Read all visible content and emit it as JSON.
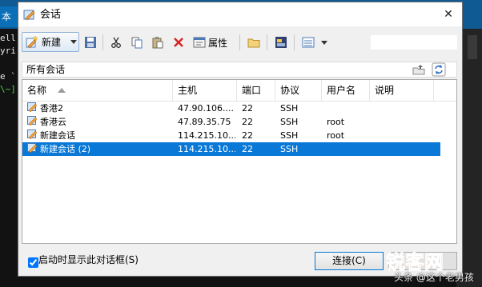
{
  "terminal": {
    "tab_label": "本",
    "lines": [
      "ell",
      "yri",
      "",
      "e `",
      "\\~]"
    ]
  },
  "dialog": {
    "title": "会话",
    "close_glyph": "✕"
  },
  "toolbar": {
    "new_label": "新建",
    "properties_label": "属性",
    "search_placeholder": ""
  },
  "folder": {
    "path": "所有会话"
  },
  "session_list": {
    "columns": [
      "名称",
      "主机",
      "端口",
      "协议",
      "用户名",
      "说明"
    ],
    "rows": [
      {
        "name": "香港2",
        "host": "47.90.106....",
        "port": "22",
        "protocol": "SSH",
        "user": "",
        "note": ""
      },
      {
        "name": "香港云",
        "host": "47.89.35.75",
        "port": "22",
        "protocol": "SSH",
        "user": "root",
        "note": ""
      },
      {
        "name": "新建会话",
        "host": "114.215.10...",
        "port": "22",
        "protocol": "SSH",
        "user": "root",
        "note": ""
      },
      {
        "name": "新建会话 (2)",
        "host": "114.215.10...",
        "port": "22",
        "protocol": "SSH",
        "user": "",
        "note": "",
        "selected": true
      }
    ]
  },
  "footer": {
    "startup_label": "启动时显示此对话框(S)",
    "startup_checked": true,
    "connect_label": "连接(C)"
  },
  "watermark": {
    "logo_text": "锐客网",
    "caption": "头条 @这个老男孩"
  },
  "colors": {
    "selection": "#0a78d7",
    "terminal_titlebar": "#0f5a93",
    "connect_border": "#0078d7"
  }
}
